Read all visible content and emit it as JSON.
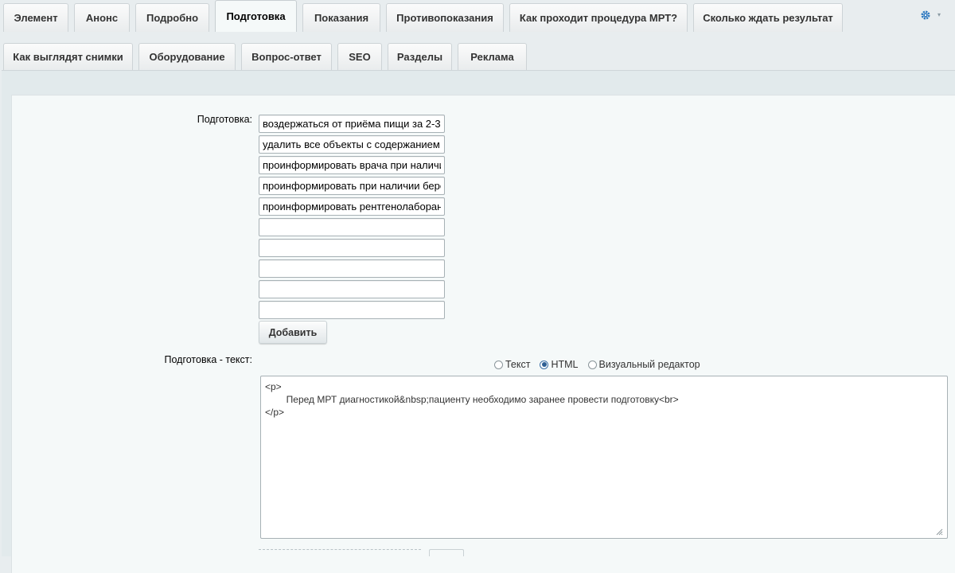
{
  "tabs_row1": [
    {
      "label": "Элемент",
      "active": false
    },
    {
      "label": "Анонс",
      "active": false
    },
    {
      "label": "Подробно",
      "active": false
    },
    {
      "label": "Подготовка",
      "active": true
    },
    {
      "label": "Показания",
      "active": false
    },
    {
      "label": "Противопоказания",
      "active": false
    },
    {
      "label": "Как проходит процедура МРТ?",
      "active": false
    },
    {
      "label": "Сколько ждать результат",
      "active": false
    }
  ],
  "tabs_row2": [
    {
      "label": "Как выглядят снимки"
    },
    {
      "label": "Оборудование"
    },
    {
      "label": "Вопрос-ответ"
    },
    {
      "label": "SEO"
    },
    {
      "label": "Разделы"
    },
    {
      "label": "Реклама"
    }
  ],
  "settings_icon": "gear-icon",
  "form": {
    "prep_label": "Подготовка:",
    "prep_items": [
      "воздержаться от приёма пищи за 2-3",
      "удалить все объекты с содержанием м",
      "проинформировать врача при наличии",
      "проинформировать при наличии берем",
      "проинформировать рентгенолаборант",
      "",
      "",
      "",
      "",
      ""
    ],
    "add_button": "Добавить",
    "text_label": "Подготовка - текст:",
    "editor_modes": [
      {
        "label": "Текст",
        "checked": false
      },
      {
        "label": "HTML",
        "checked": true
      },
      {
        "label": "Визуальный редактор",
        "checked": false
      }
    ],
    "editor_value": "<p>\n\tПеред МРТ диагностикой&nbsp;пациенту необходимо заранее провести подготовку<br>\n</p>"
  },
  "colors": {
    "accent": "#3a86c8",
    "background": "#e8edef",
    "panel": "#f5f9f9"
  }
}
